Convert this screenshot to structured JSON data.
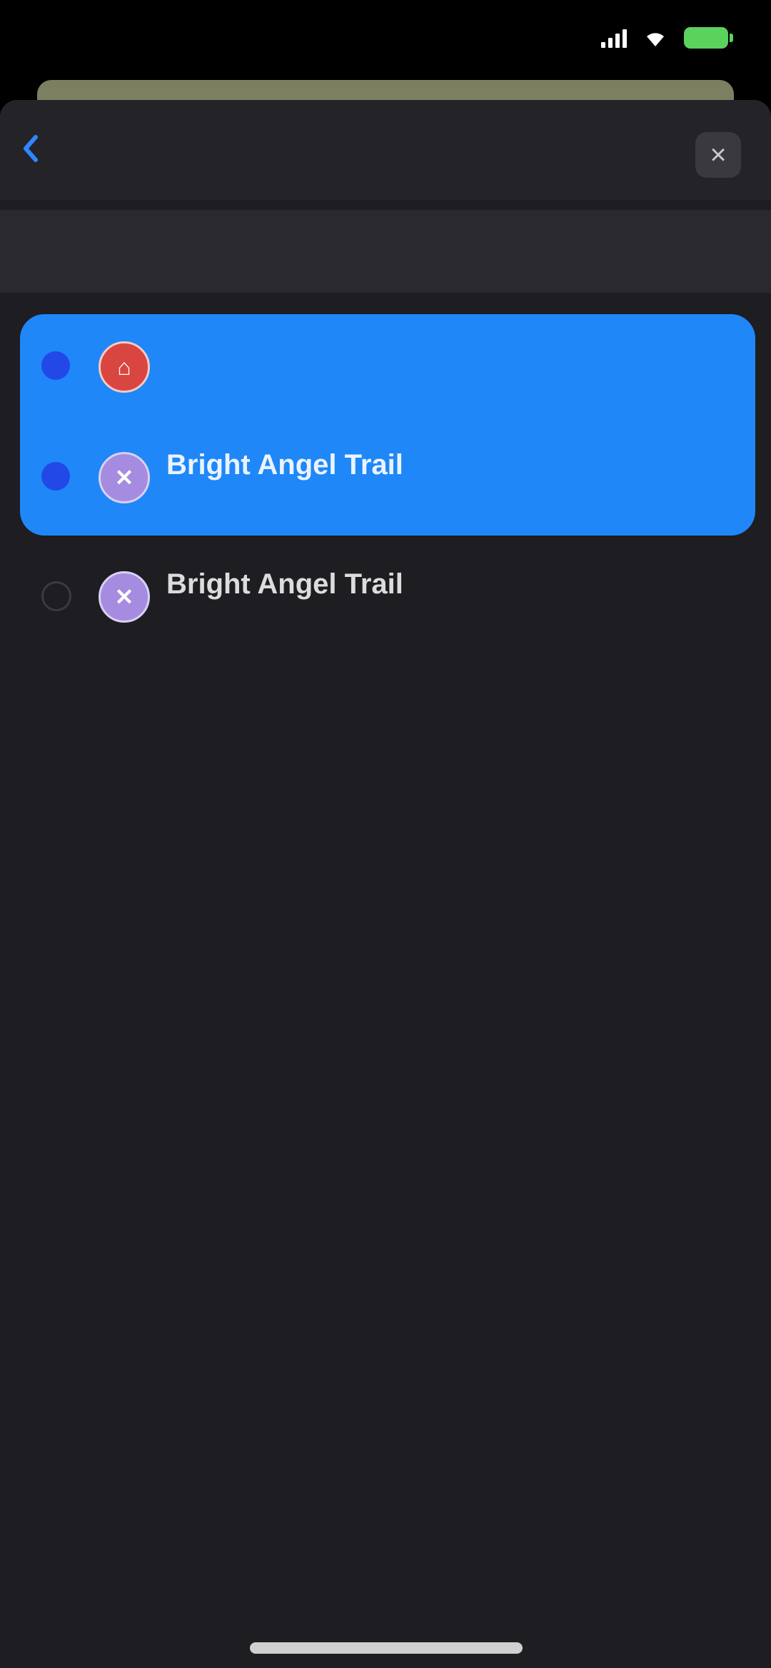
{
  "status_bar": {
    "title": "",
    "battery_color": "#5bd15e"
  },
  "nav": {
    "back_label": "",
    "title": "",
    "close_icon": "close-icon"
  },
  "toolbar": {
    "left_label": "",
    "right_label": ""
  },
  "waypoints": [
    {
      "name": "",
      "coords": "",
      "icon": "red-marker-icon",
      "selected": true
    },
    {
      "name": "Bright Angel Trail",
      "coords": "",
      "icon": "purple-marker-icon",
      "selected": true
    },
    {
      "name": "Bright Angel Trail",
      "coords": "",
      "icon": "purple-marker-icon",
      "selected": false
    }
  ],
  "colors": {
    "accent": "#2f86ff",
    "selection": "#1f87f8",
    "background": "#1e1d21"
  }
}
